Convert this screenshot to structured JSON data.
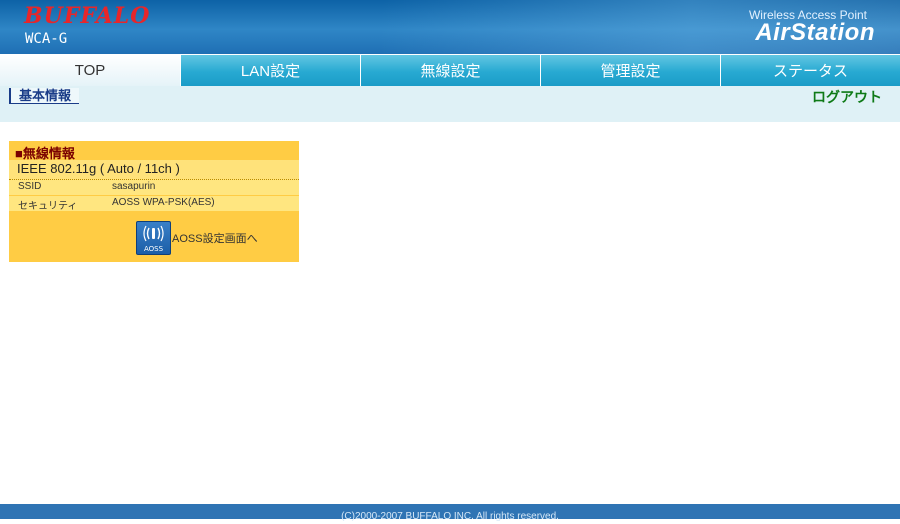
{
  "header": {
    "brand": "BUFFALO",
    "model": "WCA-G",
    "product_subtitle": "Wireless Access Point",
    "product_title": "AirStation"
  },
  "tabs": [
    {
      "label": "TOP",
      "active": true
    },
    {
      "label": "LAN設定",
      "active": false
    },
    {
      "label": "無線設定",
      "active": false
    },
    {
      "label": "管理設定",
      "active": false
    },
    {
      "label": "ステータス",
      "active": false
    }
  ],
  "subnav": {
    "active_item": "基本情報",
    "logout": "ログアウト"
  },
  "wireless_panel": {
    "title": "■無線情報",
    "mode": "IEEE 802.11g ( Auto / 11ch )",
    "rows": [
      {
        "key": "SSID",
        "value": "sasapurin"
      },
      {
        "key": "セキュリティ",
        "value": "AOSS WPA-PSK(AES)"
      }
    ],
    "aoss_icon_label": "AOSS",
    "aoss_link": "AOSS設定画面へ"
  },
  "footer": {
    "copyright": "(C)2000-2007 BUFFALO INC. All rights reserved."
  },
  "colors": {
    "header_blue": "#1f6fb4",
    "tab_blue": "#27a9d2",
    "panel_orange": "#ffcc44",
    "panel_title_red": "#7a0000",
    "logout_green": "#0e7a17",
    "brand_red": "#e8262a"
  }
}
